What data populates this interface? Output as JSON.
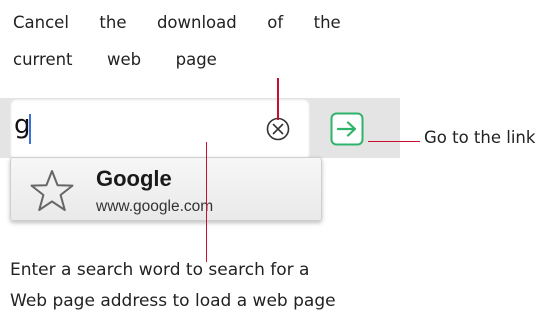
{
  "annotations": {
    "cancel_line1": "Cancel  the  download  of  the",
    "cancel_line2": "current  web  page",
    "enter_line1": "Enter a search word to search for a",
    "enter_line2": "Web page address to load a web page",
    "go": "Go to the link"
  },
  "address_bar": {
    "value": "g",
    "clear_icon": "circle-x-icon",
    "go_icon": "arrow-right-icon"
  },
  "suggestion": {
    "icon": "star-icon",
    "title": "Google",
    "url": "www.google.com"
  },
  "colors": {
    "accent_green": "#2fb36a",
    "leader_red": "#c8102e",
    "toolbar_bg": "#e4e4e4"
  }
}
